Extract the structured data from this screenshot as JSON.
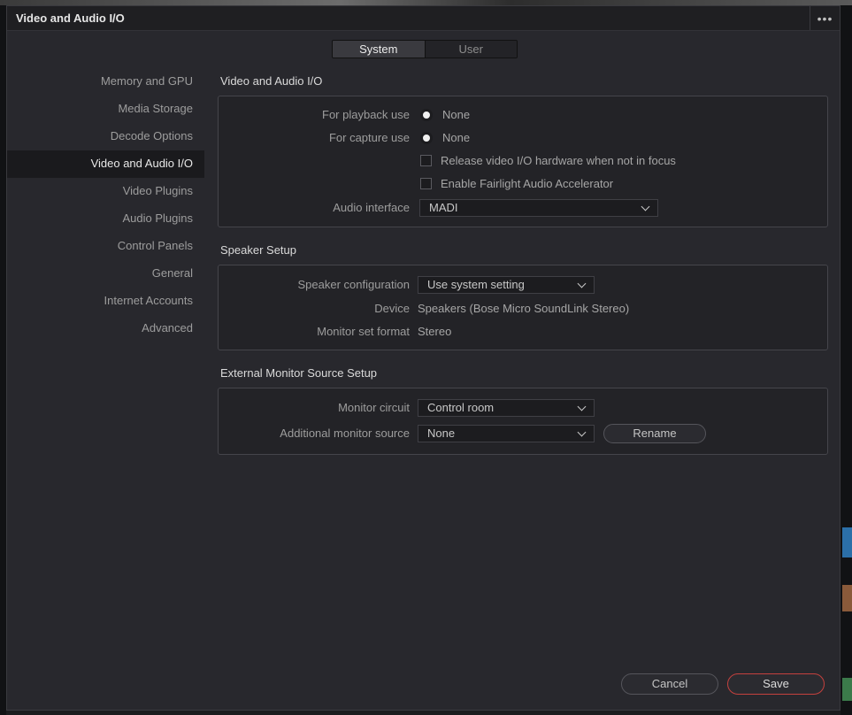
{
  "window": {
    "title": "Video and Audio I/O",
    "menu_icon": "more-horizontal-icon"
  },
  "tabs": [
    {
      "label": "System",
      "active": true
    },
    {
      "label": "User",
      "active": false
    }
  ],
  "sidebar": {
    "items": [
      {
        "label": "Memory and GPU"
      },
      {
        "label": "Media Storage"
      },
      {
        "label": "Decode Options"
      },
      {
        "label": "Video and Audio I/O",
        "active": true
      },
      {
        "label": "Video Plugins"
      },
      {
        "label": "Audio Plugins"
      },
      {
        "label": "Control Panels"
      },
      {
        "label": "General"
      },
      {
        "label": "Internet Accounts"
      },
      {
        "label": "Advanced"
      }
    ]
  },
  "video_audio_io": {
    "title": "Video and Audio I/O",
    "playback_label": "For playback use",
    "playback_value": "None",
    "capture_label": "For capture use",
    "capture_value": "None",
    "release_hw_label": "Release video I/O hardware when not in focus",
    "release_hw_checked": false,
    "fairlight_label": "Enable Fairlight Audio Accelerator",
    "fairlight_checked": false,
    "audio_interface_label": "Audio interface",
    "audio_interface_value": "MADI"
  },
  "speaker_setup": {
    "title": "Speaker Setup",
    "config_label": "Speaker configuration",
    "config_value": "Use system setting",
    "device_label": "Device",
    "device_value": "Speakers (Bose Micro SoundLink Stereo)",
    "format_label": "Monitor set format",
    "format_value": "Stereo"
  },
  "external_monitor": {
    "title": "External Monitor Source Setup",
    "circuit_label": "Monitor circuit",
    "circuit_value": "Control room",
    "additional_label": "Additional monitor source",
    "additional_value": "None",
    "rename_label": "Rename"
  },
  "footer": {
    "cancel_label": "Cancel",
    "save_label": "Save"
  },
  "colors": {
    "accent_save": "#c4413e",
    "background": "#28282d",
    "active_item": "#1a1a1d"
  }
}
